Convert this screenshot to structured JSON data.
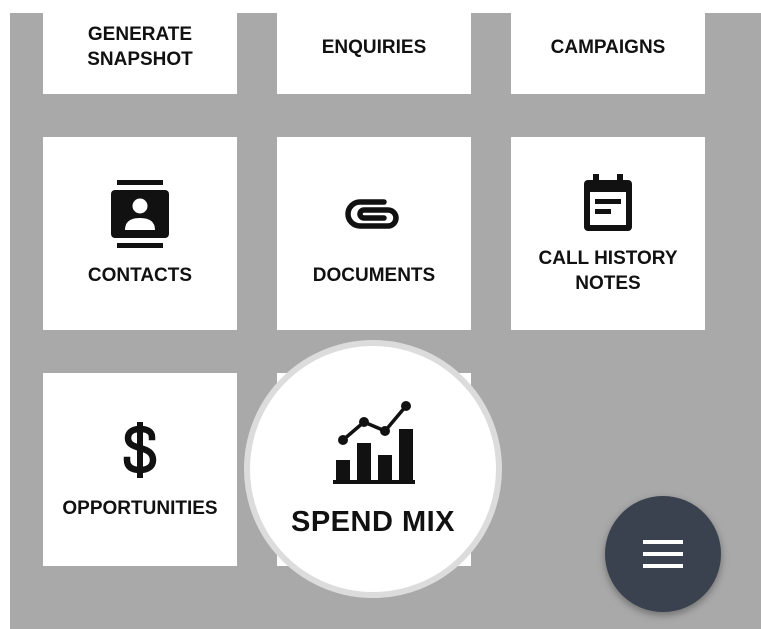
{
  "tiles": {
    "generate_snapshot": {
      "label": "GENERATE SNAPSHOT"
    },
    "enquiries": {
      "label": "ENQUIRIES"
    },
    "campaigns": {
      "label": "CAMPAIGNS"
    },
    "contacts": {
      "label": "CONTACTS",
      "icon": "contacts-icon"
    },
    "documents": {
      "label": "DOCUMENTS",
      "icon": "paperclip-icon"
    },
    "call_history_notes": {
      "label": "CALL HISTORY NOTES",
      "icon": "calendar-notes-icon"
    },
    "opportunities": {
      "label": "OPPORTUNITIES",
      "icon": "dollar-icon"
    },
    "spend_mix": {
      "label": "SPEND MIX",
      "icon": "bar-line-chart-icon"
    }
  },
  "fab": {
    "icon": "hamburger-menu-icon"
  },
  "colors": {
    "background": "#a9a9a9",
    "tile": "#ffffff",
    "text": "#111111",
    "fab": "#39424e",
    "focus_ring": "#dcdcdc"
  }
}
